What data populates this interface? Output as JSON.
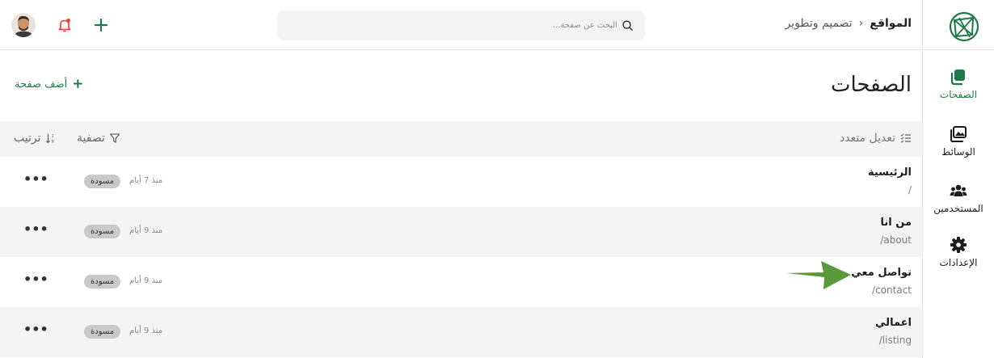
{
  "header": {
    "breadcrumb_root": "المواقع",
    "breadcrumb_separator": "›",
    "breadcrumb_current": "تصميم وتطوير",
    "search_placeholder": "البحث عن صفحة..."
  },
  "sidebar": {
    "items": [
      {
        "label": "الصفحات",
        "icon": "pages-icon",
        "active": true
      },
      {
        "label": "الوسائط",
        "icon": "media-icon",
        "active": false
      },
      {
        "label": "المستخدمين",
        "icon": "users-icon",
        "active": false
      },
      {
        "label": "الإعدادات",
        "icon": "gear-icon",
        "active": false
      }
    ]
  },
  "main": {
    "title": "الصفحات",
    "add_page_label": "أضف صفحة",
    "bulk_edit_label": "تعديل متعدد",
    "filter_label": "تصفية",
    "sort_label": "ترتيب"
  },
  "pages": [
    {
      "title": "الرئيسية",
      "slug": "/",
      "time": "منذ 7 أيام",
      "status": "مسودة",
      "more": "•••"
    },
    {
      "title": "من انا",
      "slug": "/about",
      "time": "منذ 9 أيام",
      "status": "مسودة",
      "more": "•••"
    },
    {
      "title": "تواصل معي",
      "slug": "/contact",
      "time": "منذ 9 أيام",
      "status": "مسودة",
      "more": "•••"
    },
    {
      "title": "اعمالي",
      "slug": "/listing",
      "time": "منذ 9 أيام",
      "status": "مسودة",
      "more": "•••"
    }
  ],
  "colors": {
    "accent": "#1e7a45",
    "arrow": "#5a9a3c",
    "toolbar_bg": "#f4f4f4",
    "badge_bg": "#c9c9c9",
    "notification_dot": "#e53935"
  }
}
